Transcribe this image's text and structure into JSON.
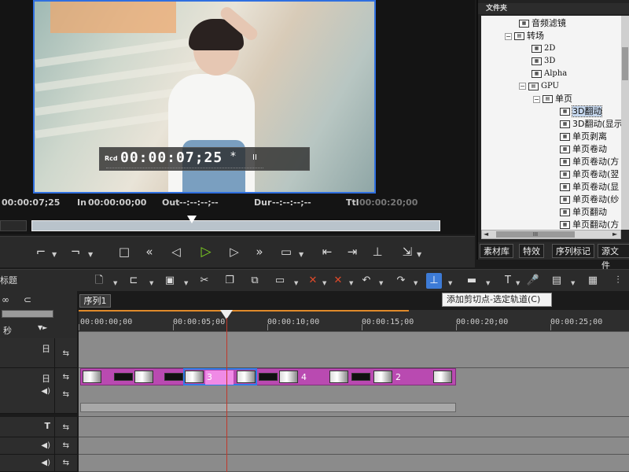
{
  "preview": {
    "timecode_label": "Rcd",
    "timecode": "00:00:07;25",
    "timecode_marker": "*",
    "pause_glyph": "II",
    "current": "00:00:07;25",
    "in_label": "In",
    "in_value": "00:00:00;00",
    "out_label": "Out",
    "out_value": "--:--:--;--",
    "dur_label": "Dur",
    "dur_value": "--:--:--;--",
    "ttl_label": "Ttl",
    "ttl_value": "00:00:20;00"
  },
  "folder_panel": {
    "title": "文件夹",
    "nodes": [
      "音频滤镜",
      "转场",
      "2D",
      "3D",
      "Alpha",
      "GPU",
      "单页",
      "3D翻动",
      "3D翻动(显示",
      "单页剥离",
      "单页卷动",
      "单页卷动(方",
      "单页卷动(翌",
      "单页卷动(显",
      "单页卷动(纱",
      "单页翻动",
      "单页翻动(方"
    ],
    "toggle_minus": "−",
    "scroll_left": "◄",
    "scroll_right": "►",
    "scroll_thumb": "III",
    "tabs": [
      "素材库",
      "特效",
      "序列标记",
      "源文件"
    ]
  },
  "tools": {
    "title": "标题",
    "tooltip": "添加剪切点-选定轨道(C)"
  },
  "timeline": {
    "sequence_tab": "序列1",
    "unit_label": "秒",
    "ruler": [
      "00:00:00;00",
      "00:00:05;00",
      "00:00:10;00",
      "00:00:15;00",
      "00:00:20;00",
      "00:00:25;00"
    ],
    "clip_numbers": [
      "3",
      "4",
      "2"
    ],
    "video_track_glyph": "日",
    "title_track_glyph": "T"
  },
  "colors": {
    "accent": "#3d7bd6",
    "clip": "#b94ab1",
    "play": "#7ed321",
    "playhead": "#c0392b"
  }
}
